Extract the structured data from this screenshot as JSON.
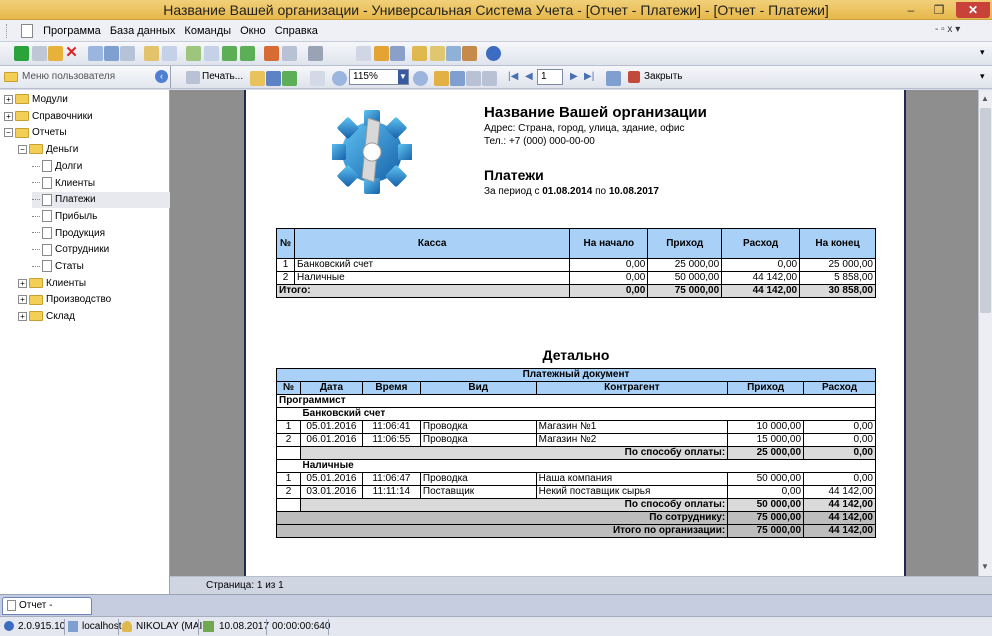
{
  "window": {
    "title": "Название Вашей организации - Универсальная Система Учета - [Отчет - Платежи] - [Отчет - Платежи]"
  },
  "menu": [
    "Программа",
    "База данных",
    "Команды",
    "Окно",
    "Справка"
  ],
  "sidebar": {
    "header": "Меню пользователя",
    "items": [
      {
        "label": "Модули",
        "type": "folder",
        "expand": "+",
        "level": 0
      },
      {
        "label": "Справочники",
        "type": "folder",
        "expand": "+",
        "level": 0
      },
      {
        "label": "Отчеты",
        "type": "folder",
        "expand": "−",
        "level": 0
      },
      {
        "label": "Деньги",
        "type": "folder",
        "expand": "−",
        "level": 1
      },
      {
        "label": "Долги",
        "type": "doc",
        "level": 2
      },
      {
        "label": "Клиенты",
        "type": "doc",
        "level": 2
      },
      {
        "label": "Платежи",
        "type": "doc",
        "level": 2,
        "selected": true
      },
      {
        "label": "Прибыль",
        "type": "doc",
        "level": 2
      },
      {
        "label": "Продукция",
        "type": "doc",
        "level": 2
      },
      {
        "label": "Сотрудники",
        "type": "doc",
        "level": 2
      },
      {
        "label": "Статы",
        "type": "doc",
        "level": 2
      },
      {
        "label": "Клиенты",
        "type": "folder",
        "expand": "+",
        "level": 1
      },
      {
        "label": "Производство",
        "type": "folder",
        "expand": "+",
        "level": 1
      },
      {
        "label": "Склад",
        "type": "folder",
        "expand": "+",
        "level": 1
      }
    ]
  },
  "report_toolbar": {
    "print_label": "Печать...",
    "zoom": "115%",
    "page_number": "1",
    "close_label": "Закрыть"
  },
  "report": {
    "org_name": "Название Вашей организации",
    "address": "Адрес: Страна, город, улица, здание, офис",
    "phone": "Тел.: +7 (000) 000-00-00",
    "title": "Платежи",
    "period_prefix": "За период с ",
    "period_from": "01.08.2014",
    "period_mid": " по ",
    "period_to": "10.08.2017",
    "summary": {
      "headers": [
        "№",
        "Касса",
        "На начало",
        "Приход",
        "Расход",
        "На конец"
      ],
      "rows": [
        [
          "1",
          "Банковский счет",
          "0,00",
          "25 000,00",
          "0,00",
          "25 000,00"
        ],
        [
          "2",
          "Наличные",
          "0,00",
          "50 000,00",
          "44 142,00",
          "5 858,00"
        ]
      ],
      "total": [
        "Итого:",
        "0,00",
        "75 000,00",
        "44 142,00",
        "30 858,00"
      ]
    },
    "detail_title": "Детально",
    "detail": {
      "group_header": "Платежный документ",
      "headers": [
        "№",
        "Дата",
        "Время",
        "Вид",
        "Контрагент",
        "Приход",
        "Расход"
      ],
      "employee": "Программист",
      "groups": [
        {
          "name": "Банковский счет",
          "rows": [
            [
              "1",
              "05.01.2016",
              "11:06:41",
              "Проводка",
              "Магазин №1",
              "10 000,00",
              "0,00"
            ],
            [
              "2",
              "06.01.2016",
              "11:06:55",
              "Проводка",
              "Магазин №2",
              "15 000,00",
              "0,00"
            ]
          ],
          "subtotal": [
            "По способу оплаты:",
            "25 000,00",
            "0,00"
          ]
        },
        {
          "name": "Наличные",
          "rows": [
            [
              "1",
              "05.01.2016",
              "11:06:47",
              "Проводка",
              "Наша компания",
              "50 000,00",
              "0,00"
            ],
            [
              "2",
              "03.01.2016",
              "11:11:14",
              "Поставщик",
              "Некий поставщик сырья",
              "0,00",
              "44 142,00"
            ]
          ],
          "subtotal": [
            "По способу оплаты:",
            "50 000,00",
            "44 142,00"
          ]
        }
      ],
      "employee_total": [
        "По сотруднику:",
        "75 000,00",
        "44 142,00"
      ],
      "org_total": [
        "Итого по организации:",
        "75 000,00",
        "44 142,00"
      ]
    }
  },
  "page_status": "Страница: 1 из 1",
  "tab": "Отчет - Платежи",
  "statusbar": {
    "version": "2.0.915.10",
    "host": "localhost",
    "user": "NIKOLAY (MAIN)",
    "date": "10.08.2017",
    "timer": "00:00:00:640"
  }
}
